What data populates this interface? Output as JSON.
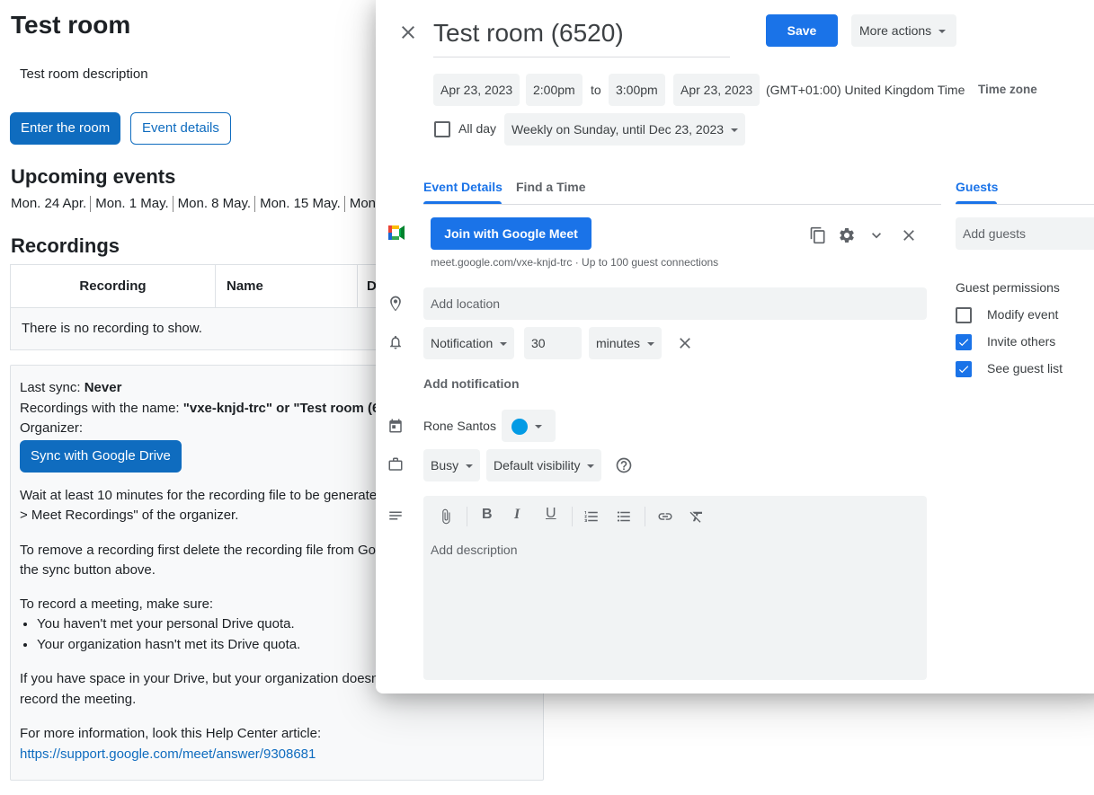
{
  "background_page": {
    "title": "Test room",
    "description": "Test room description",
    "enter_button": "Enter the room",
    "details_button": "Event details",
    "upcoming_heading": "Upcoming events",
    "upcoming_events": [
      "Mon. 24 Apr.",
      "Mon. 1 May.",
      "Mon. 8 May.",
      "Mon. 15 May.",
      "Mon"
    ],
    "recordings_heading": "Recordings",
    "table_headers": [
      "Recording",
      "Name",
      "D"
    ],
    "empty_message": "There is no recording to show.",
    "sync_label": "Last sync: ",
    "sync_value": "Never",
    "recordings_name_label": "Recordings with the name: ",
    "recordings_name_value": "\"vxe-knjd-trc\" or \"Test room (6",
    "organizer_label": "Organizer:",
    "sync_button": "Sync with Google Drive",
    "wait_text_1": "Wait at least 10 minutes for the recording file to be generate",
    "wait_text_2": "> Meet Recordings\" of the organizer.",
    "remove_text_1": "To remove a recording first delete the recording file from Go",
    "remove_text_2": "the sync button above.",
    "record_heading": "To record a meeting, make sure:",
    "record_items": [
      "You haven't met your personal Drive quota.",
      "Your organization hasn't met its Drive quota."
    ],
    "space_text_1": "If you have space in your Drive, but your organization doesn",
    "space_text_1_tail": "y",
    "space_text_2": "record the meeting.",
    "more_info": "For more information, look this Help Center article:",
    "help_link": "https://support.google.com/meet/answer/9308681"
  },
  "dialog": {
    "title": "Test room (6520)",
    "save": "Save",
    "more_actions": "More actions",
    "start_date": "Apr 23, 2023",
    "start_time": "2:00pm",
    "to": "to",
    "end_time": "3:00pm",
    "end_date": "Apr 23, 2023",
    "timezone": "(GMT+01:00) United Kingdom Time",
    "timezone_button": "Time zone",
    "all_day": "All day",
    "recurrence": "Weekly on Sunday, until Dec 23, 2023",
    "tabs": [
      "Event Details",
      "Find a Time"
    ],
    "guests_tab": "Guests",
    "meet_button": "Join with Google Meet",
    "meet_link": "meet.google.com/vxe-knjd-trc · Up to 100 guest connections",
    "location_placeholder": "Add location",
    "notification_type": "Notification",
    "notification_value": "30",
    "notification_unit": "minutes",
    "add_notification": "Add notification",
    "calendar_owner": "Rone Santos",
    "calendar_color": "#039be5",
    "busy": "Busy",
    "visibility": "Default visibility",
    "description_placeholder": "Add description",
    "add_guests": "Add guests",
    "guest_permissions_heading": "Guest permissions",
    "permissions": [
      {
        "label": "Modify event",
        "checked": false
      },
      {
        "label": "Invite others",
        "checked": true
      },
      {
        "label": "See guest list",
        "checked": true
      }
    ],
    "accent": "#1a73e8"
  }
}
